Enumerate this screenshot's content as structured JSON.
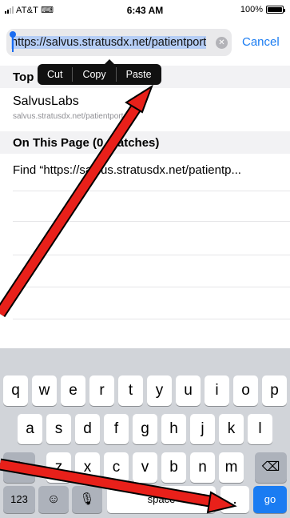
{
  "status_bar": {
    "carrier": "AT&T",
    "time": "6:43 AM",
    "battery": "100%",
    "battery_level": 1.0
  },
  "address_bar": {
    "url": "https://salvus.stratusdx.net/patientport",
    "cancel_label": "Cancel"
  },
  "edit_menu": {
    "items": [
      "Cut",
      "Copy",
      "Paste"
    ]
  },
  "results": {
    "top_hits_header": "Top",
    "top_hit": {
      "title": "SalvusLabs",
      "subtitle": "salvus.stratusdx.net/patientportal"
    },
    "on_this_page_header": "On This Page (0 matches)",
    "find_text": "Find “https://salvus.stratusdx.net/patientp..."
  },
  "keyboard": {
    "row1": [
      "q",
      "w",
      "e",
      "r",
      "t",
      "y",
      "u",
      "i",
      "o",
      "p"
    ],
    "row2": [
      "a",
      "s",
      "d",
      "f",
      "g",
      "h",
      "j",
      "k",
      "l"
    ],
    "row3": [
      "z",
      "x",
      "c",
      "v",
      "b",
      "n",
      "m"
    ],
    "numbers_label": "123",
    "space_label": "space",
    "period_label": ".",
    "go_label": "go"
  },
  "colors": {
    "accent": "#1a7cf2",
    "annotation": "#e8201a"
  }
}
